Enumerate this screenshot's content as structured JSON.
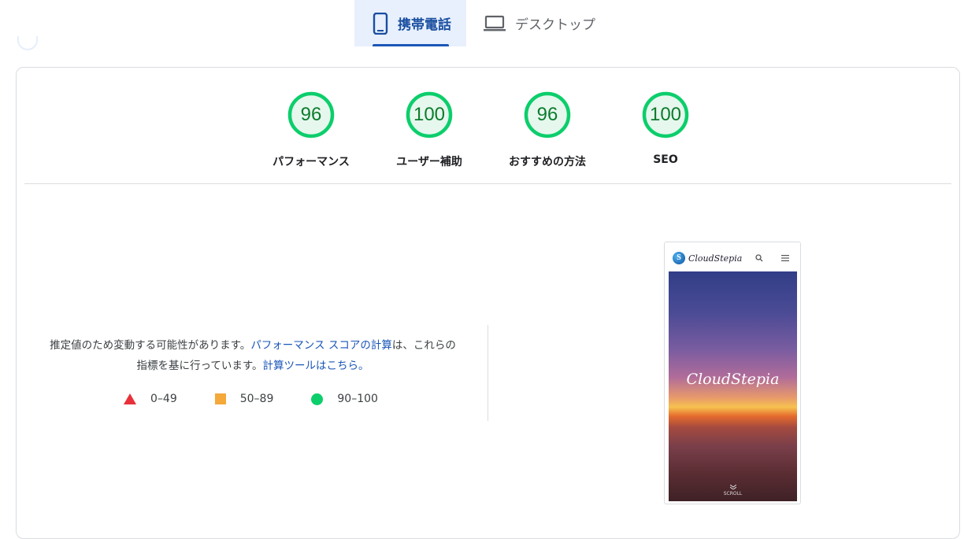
{
  "tabs": [
    {
      "label": "携帯電話",
      "icon": "smartphone-icon",
      "active": true
    },
    {
      "label": "デスクトップ",
      "icon": "laptop-icon",
      "active": false
    }
  ],
  "gauges": [
    {
      "score": "96",
      "label": "パフォーマンス"
    },
    {
      "score": "100",
      "label": "ユーザー補助"
    },
    {
      "score": "96",
      "label": "おすすめの方法"
    },
    {
      "score": "100",
      "label": "SEO"
    }
  ],
  "explanation": {
    "text_before": "推定値のため変動する可能性があります。",
    "link1": "パフォーマンス スコアの計算",
    "text_middle": "は、これらの指標を基に行っています。",
    "link2": "計算ツールはこちら。"
  },
  "legend": [
    {
      "range": "0–49",
      "shape": "triangle",
      "color": "#e8303a"
    },
    {
      "range": "50–89",
      "shape": "square",
      "color": "#f4a93a"
    },
    {
      "range": "90–100",
      "shape": "circle",
      "color": "#0cce6b"
    }
  ],
  "colors": {
    "good": "#0cce6b",
    "good_bg": "#e6f7ee",
    "accent": "#1a56b8"
  },
  "screenshot": {
    "site_name": "CloudStepia",
    "hero_title": "CloudStepia",
    "scroll_label": "SCROLL"
  }
}
